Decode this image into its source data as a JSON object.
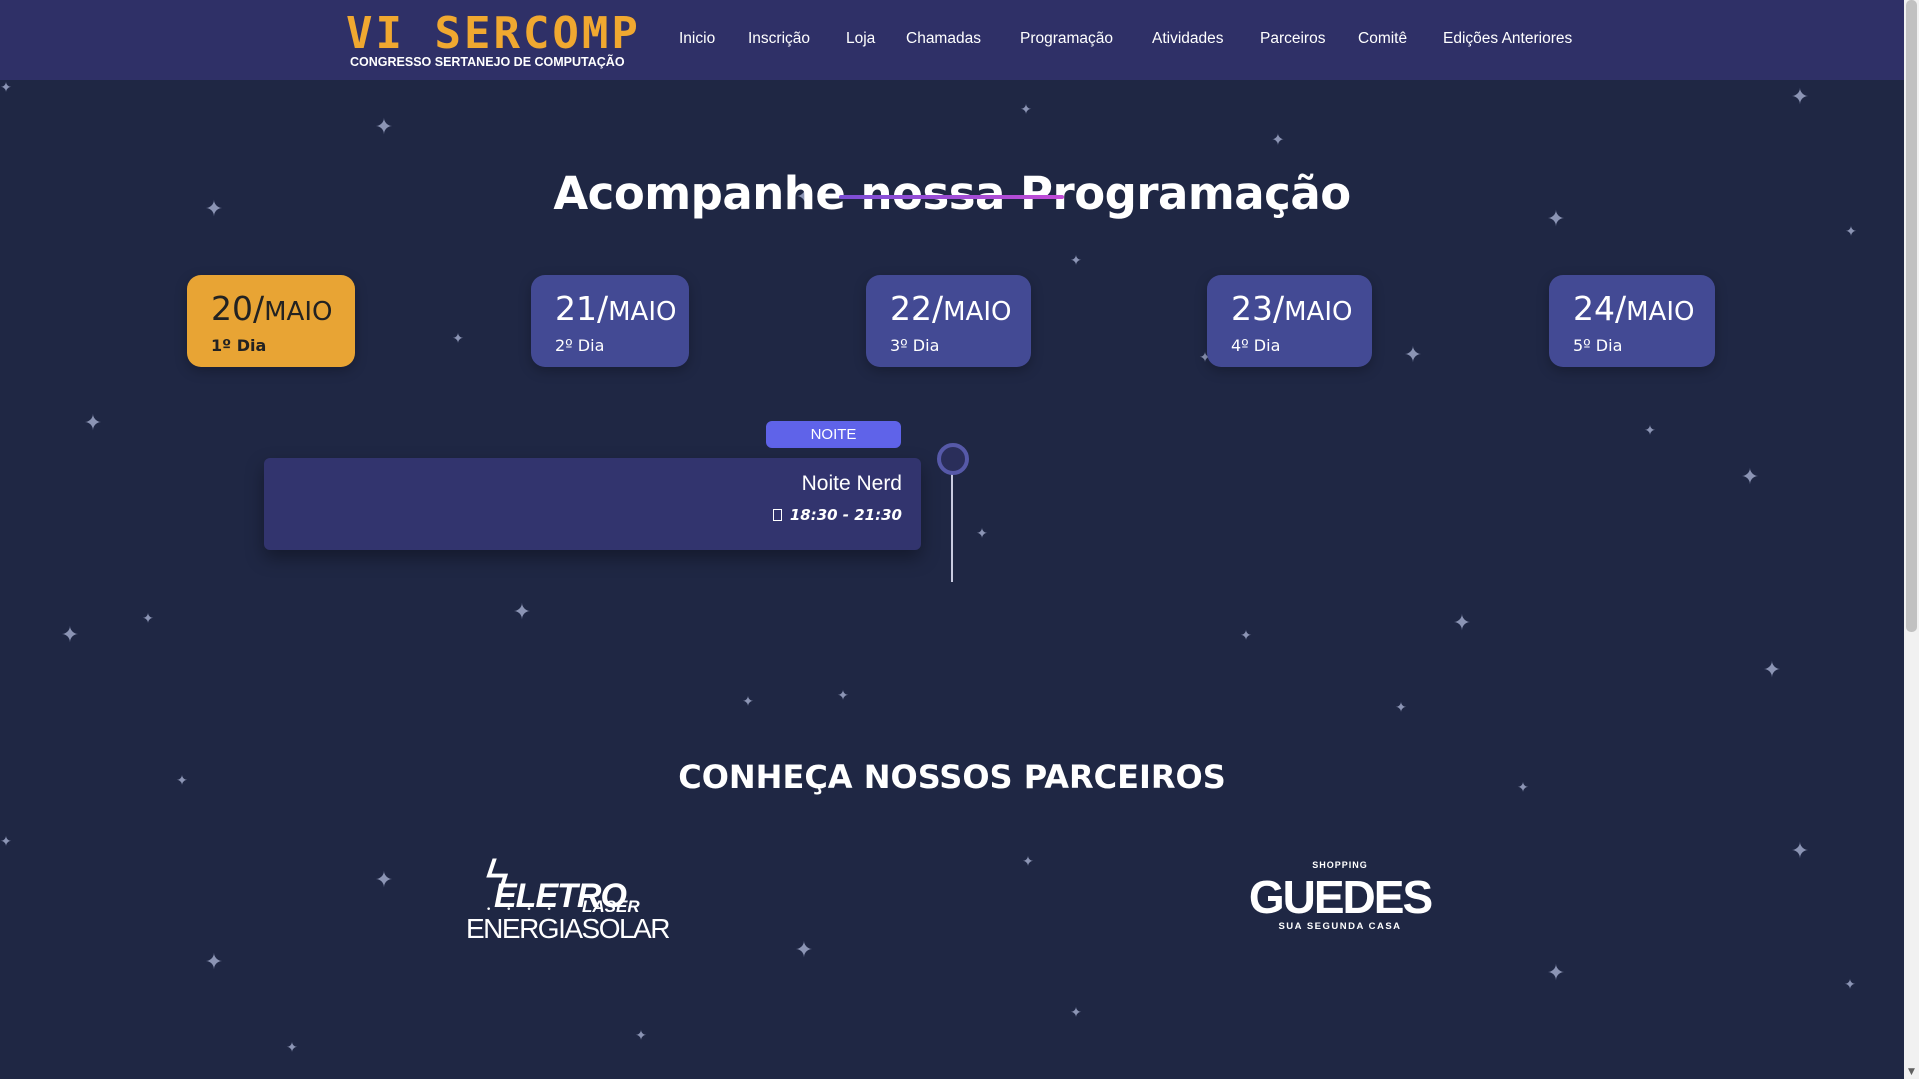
{
  "logo": {
    "title": "VI SERCOMP",
    "subtitle": "CONGRESSO SERTANEJO DE COMPUTAÇÃO"
  },
  "nav": {
    "items": [
      "Inicio",
      "Inscrição",
      "Loja",
      "Chamadas",
      "Programação",
      "Atividades",
      "Parceiros",
      "Comitê",
      "Edições Anteriores"
    ]
  },
  "schedule": {
    "title": "Acompanhe nossa Programação",
    "days": [
      {
        "day": "20/",
        "month": "MAIO",
        "label": "1º Dia",
        "active": true
      },
      {
        "day": "21/",
        "month": "MAIO",
        "label": "2º Dia",
        "active": false
      },
      {
        "day": "22/",
        "month": "MAIO",
        "label": "3º Dia",
        "active": false
      },
      {
        "day": "23/",
        "month": "MAIO",
        "label": "4º Dia",
        "active": false
      },
      {
        "day": "24/",
        "month": "MAIO",
        "label": "5º Dia",
        "active": false
      }
    ],
    "period": "NOITE",
    "event": {
      "title": "Noite Nerd",
      "time": "18:30 - 21:30",
      "icon": "clock-icon"
    }
  },
  "partners": {
    "title": "CONHEÇA NOSSOS PARCEIROS",
    "eletro": {
      "bolt": "ϟ",
      "word": "ELETRO",
      "sub": "LASER",
      "dots": "• • • •",
      "tagline": "ENERGIASOLAR"
    },
    "guedes": {
      "top": "SHOPPING",
      "name": "GUEDES",
      "tagline": "SUA SEGUNDA CASA"
    }
  },
  "colors": {
    "background": "#1f2744",
    "navbar": "#2f3067",
    "accent": "#e8a434",
    "tab": "#434a94",
    "badge": "#5f63e9"
  }
}
